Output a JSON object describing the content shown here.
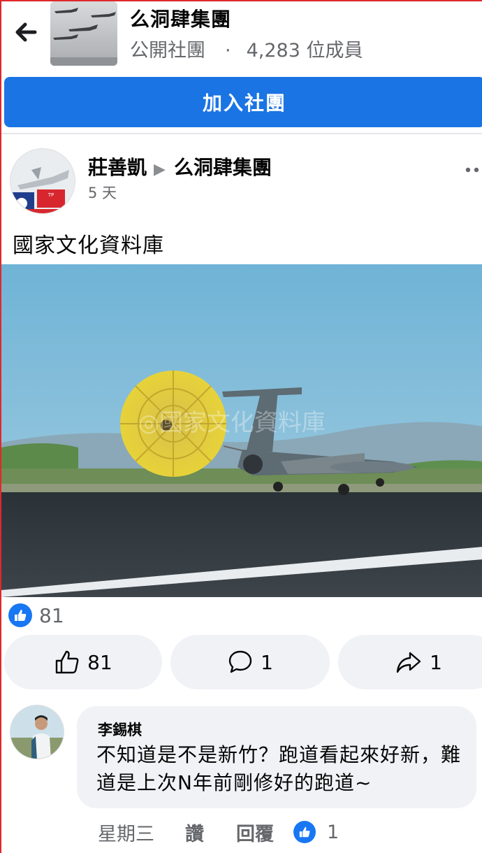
{
  "header": {
    "group_name": "么洞肆集團",
    "privacy": "公開社團",
    "separator": "·",
    "member_count": "4,283 位成員",
    "join_label": "加入社團"
  },
  "post": {
    "author": "莊善凱",
    "arrow": "▶",
    "group": "么洞肆集團",
    "time": "5 天",
    "text": "國家文化資料庫",
    "reaction_count": "81"
  },
  "actions": {
    "like_count": "81",
    "comment_count": "1",
    "share_count": "1"
  },
  "comment": {
    "name": "李錫棋",
    "text": "不知道是不是新竹？跑道看起來好新，難道是上次N年前剛修好的跑道~",
    "time": "星期三",
    "like_label": "讚",
    "reply_label": "回覆",
    "like_count": "1"
  },
  "colors": {
    "accent": "#1b74e4",
    "like_blue": "#1877f2",
    "secondary_text": "#65676b",
    "button_bg": "#f0f2f5"
  }
}
